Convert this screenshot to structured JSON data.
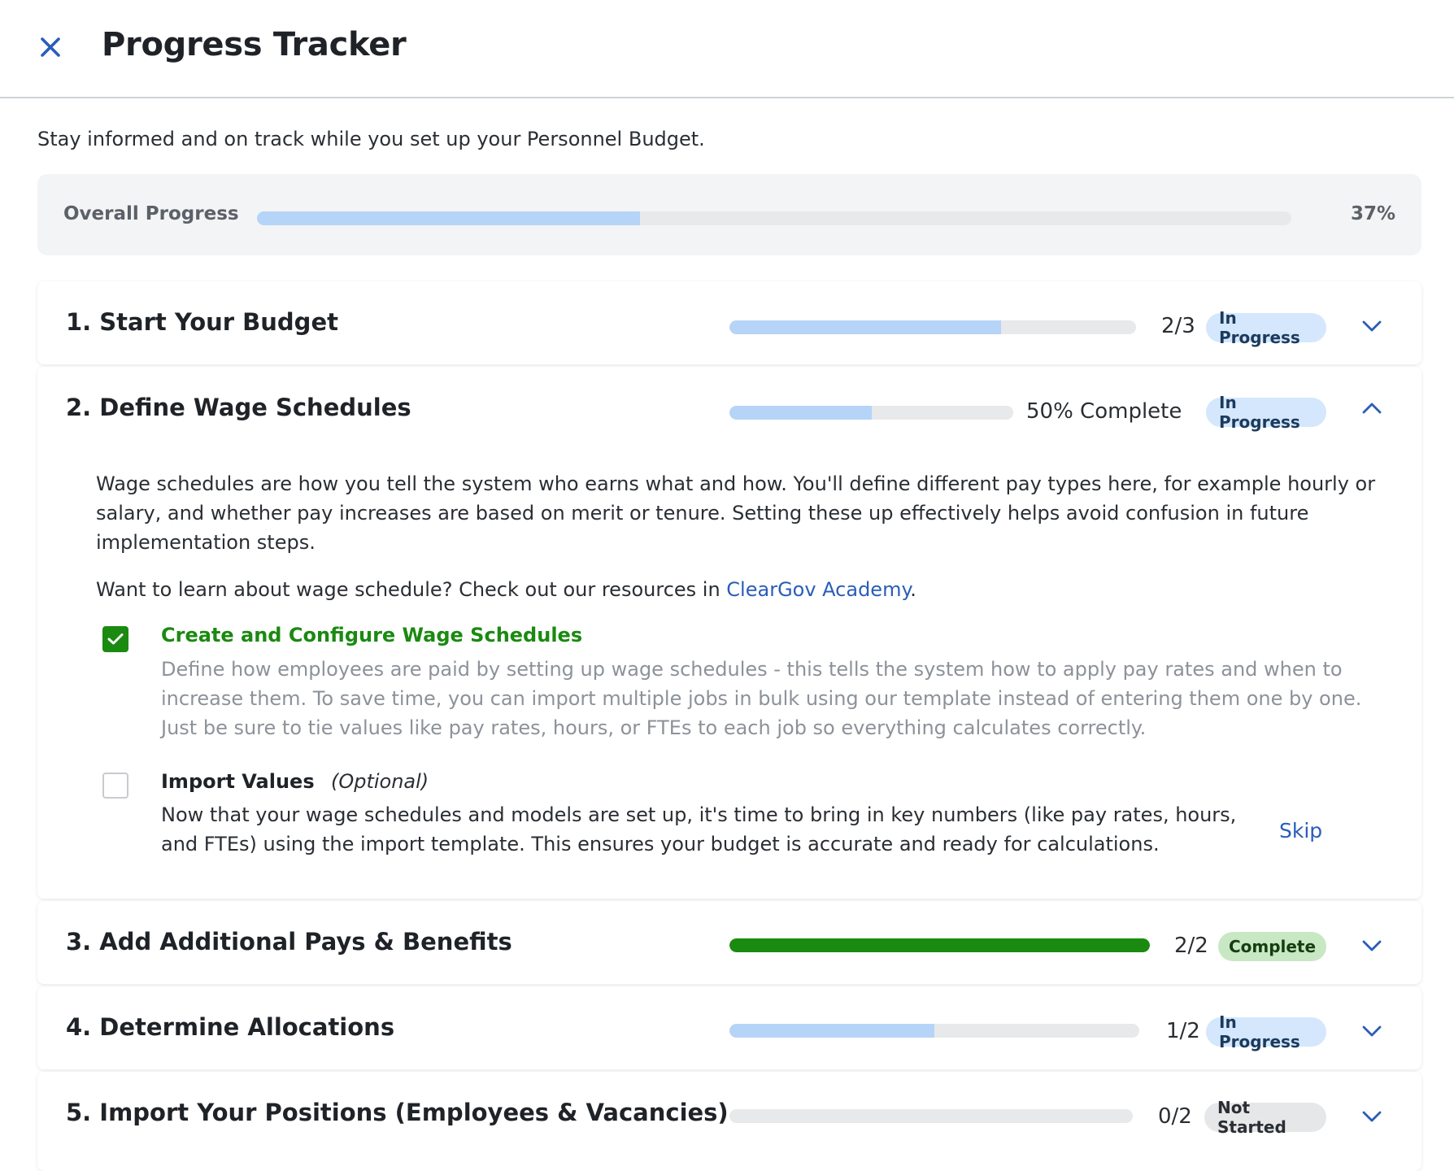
{
  "header": {
    "title": "Progress Tracker",
    "close_icon": "close-icon"
  },
  "intro": "Stay informed and on track while you set up your Personnel Budget.",
  "overall": {
    "label": "Overall Progress",
    "percent_text": "37%",
    "progress": 0.37
  },
  "colors": {
    "accent": "#2a5db8",
    "progress_fill": "#b6d4f8",
    "complete": "#1a8a10"
  },
  "sections": [
    {
      "title": "1. Start Your Budget",
      "count": "2/3",
      "status": "In Progress",
      "progress": 0.667,
      "expanded": false
    },
    {
      "title": "2. Define Wage Schedules",
      "count": "50% Complete",
      "status": "In Progress",
      "progress": 0.5,
      "expanded": true,
      "description": "Wage schedules are how you tell the system who earns what and how. You'll define different pay types here, for example hourly or salary, and whether pay increases are based on merit or tenure. Setting these up effectively helps avoid confusion in future implementation steps.",
      "learn_prefix": "Want to learn about wage schedule? Check out our resources in ",
      "learn_link": "ClearGov Academy",
      "learn_suffix": ".",
      "tasks": [
        {
          "title": "Create and Configure Wage Schedules",
          "checked": true,
          "description": "Define how employees are paid by setting up wage schedules - this tells the system how to apply pay rates and when to increase them. To save time, you can import multiple jobs in bulk using our template instead of entering them one by one. Just be sure to tie values like pay rates, hours, or FTEs to each job so everything calculates correctly."
        },
        {
          "title": "Import Values",
          "optional": "(Optional)",
          "checked": false,
          "description": "Now that your wage schedules and models are set up, it's time to bring in key numbers (like pay rates, hours, and FTEs) using the import template. This ensures your budget is accurate and ready for calculations.",
          "action": "Skip"
        }
      ]
    },
    {
      "title": "3. Add Additional Pays & Benefits",
      "count": "2/2",
      "status": "Complete",
      "progress": 1.0,
      "expanded": false
    },
    {
      "title": "4. Determine Allocations",
      "count": "1/2",
      "status": "In Progress",
      "progress": 0.5,
      "expanded": false
    },
    {
      "title": "5. Import Your Positions (Employees & Vacancies)",
      "count": "0/2",
      "status": "Not Started",
      "progress": 0.0,
      "expanded": false
    }
  ]
}
